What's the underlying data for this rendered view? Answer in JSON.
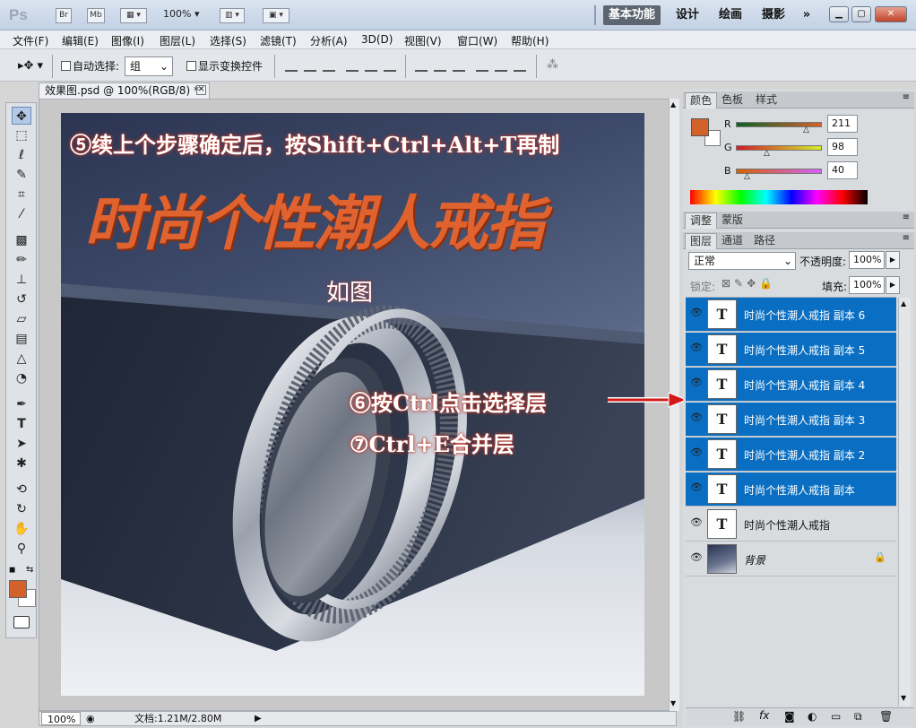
{
  "app": {
    "logo": "Ps",
    "bridge": "Br",
    "minibridge": "Mb",
    "zoom": "100%"
  },
  "workspaces": [
    "基本功能",
    "设计",
    "绘画",
    "摄影"
  ],
  "workspace_more": "»",
  "menus": [
    "文件(F)",
    "编辑(E)",
    "图像(I)",
    "图层(L)",
    "选择(S)",
    "滤镜(T)",
    "分析(A)",
    "3D(D)",
    "视图(V)",
    "窗口(W)",
    "帮助(H)"
  ],
  "options": {
    "auto_select_label": "自动选择:",
    "auto_select_value": "组",
    "show_transform_label": "显示变换控件"
  },
  "document": {
    "tab_title": "效果图.psd @ 100%(RGB/8) *",
    "zoom": "100%",
    "doc_info": "文档:1.21M/2.80M"
  },
  "canvas": {
    "step5": "⑤续上个步骤确定后，按Shift+Ctrl+Alt+T再制",
    "headline": "时尚个性潮人戒指",
    "as_shown": "如图",
    "step6": "⑥按Ctrl点击选择层",
    "step7": "⑦Ctrl+E合并层"
  },
  "color_panel": {
    "tabs": [
      "颜色",
      "色板",
      "样式"
    ],
    "r_label": "R",
    "g_label": "G",
    "b_label": "B",
    "r": 211,
    "g": 98,
    "b": 40,
    "fg_color": "#d3622a"
  },
  "adj_panel": {
    "tabs": [
      "调整",
      "蒙版"
    ]
  },
  "layers_panel": {
    "tabs": [
      "图层",
      "通道",
      "路径"
    ],
    "blend_mode": "正常",
    "opacity_label": "不透明度:",
    "opacity": "100%",
    "lock_label": "锁定:",
    "fill_label": "填充:",
    "fill": "100%",
    "text_layer_glyph": "T",
    "layers": [
      {
        "name": "时尚个性潮人戒指 副本 6",
        "selected": true
      },
      {
        "name": "时尚个性潮人戒指 副本 5",
        "selected": true
      },
      {
        "name": "时尚个性潮人戒指 副本 4",
        "selected": true
      },
      {
        "name": "时尚个性潮人戒指 副本 3",
        "selected": true
      },
      {
        "name": "时尚个性潮人戒指 副本 2",
        "selected": true
      },
      {
        "name": "时尚个性潮人戒指 副本",
        "selected": true
      },
      {
        "name": "时尚个性潮人戒指",
        "selected": false
      },
      {
        "name": "背景",
        "selected": false
      }
    ]
  },
  "colors": {
    "accent": "#d3622a",
    "selection": "#0a6fc2",
    "headline": "#e0632f"
  }
}
